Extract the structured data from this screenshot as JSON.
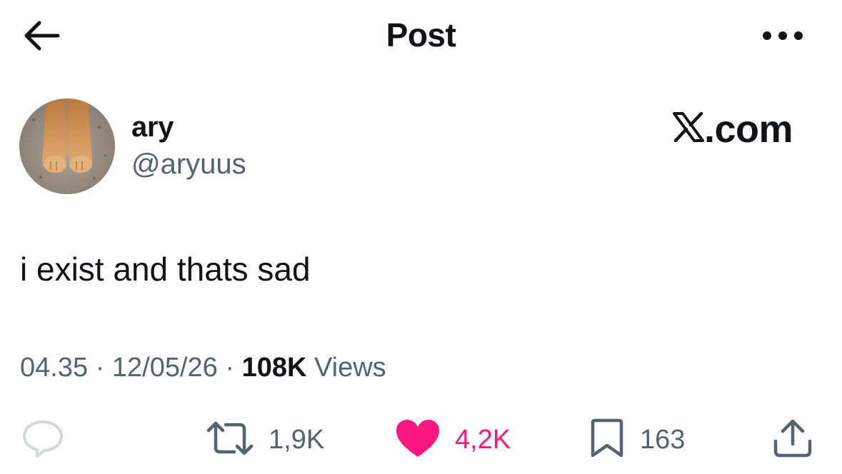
{
  "header": {
    "title": "Post"
  },
  "author": {
    "display_name": "ary",
    "handle": "@aryuus"
  },
  "watermark": {
    "text": ".com"
  },
  "post": {
    "text": "i exist and thats sad"
  },
  "meta": {
    "time": "04.35",
    "date": "12/05/26",
    "views_count": "108K",
    "views_label": "Views"
  },
  "actions": {
    "reposts": "1,9K",
    "likes": "4,2K",
    "bookmarks": "163"
  },
  "icons": {
    "back": "arrow-left-icon",
    "more": "more-horizontal-icon",
    "logo": "x-logo-icon",
    "reply": "reply-icon",
    "repost": "repost-icon",
    "like": "heart-icon",
    "bookmark": "bookmark-icon",
    "share": "share-icon"
  },
  "colors": {
    "text_primary": "#0f1419",
    "text_secondary": "#536471",
    "like_active": "#f91880",
    "reply_icon": "#cfd9de"
  }
}
